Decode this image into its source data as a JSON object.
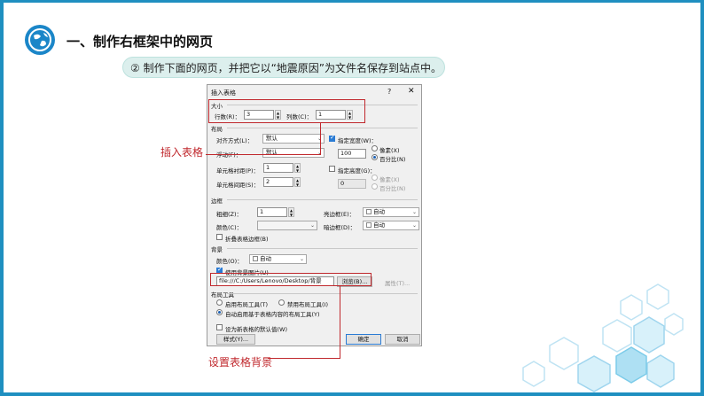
{
  "slide": {
    "title": "一、制作右框架中的网页",
    "subtitle": "② 制作下面的网页，并把它以“地震原因”为文件名保存到站点中。",
    "accent": "#1f8fc0"
  },
  "dialog": {
    "title": "插入表格",
    "help": "?",
    "close": "✕",
    "size": {
      "section": "大小",
      "rows_label": "行数(R)：",
      "rows_value": "3",
      "cols_label": "列数(C)：",
      "cols_value": "1"
    },
    "layout": {
      "section": "布局",
      "align_label": "对齐方式(L)：",
      "align_value": "默认",
      "float_label": "浮动(F)：",
      "float_value": "默认",
      "padding_label": "单元格衬距(P)：",
      "padding_value": "1",
      "spacing_label": "单元格间距(S)：",
      "spacing_value": "2",
      "spec_width_label": "指定宽度(W)：",
      "spec_width_value": "100",
      "pixels_label": "像素(X)",
      "percent_label": "百分比(N)",
      "spec_height_label": "指定高度(G)：",
      "spec_height_value": "0",
      "pixels_label2": "像素(X)",
      "percent_label2": "百分比(N)"
    },
    "border": {
      "section": "边框",
      "thickness_label": "粗细(Z)：",
      "thickness_value": "1",
      "color_label": "颜色(C)：",
      "light_label": "亮边框(E)：",
      "light_value": "自动",
      "dark_label": "暗边框(D)：",
      "dark_value": "自动",
      "collapse_label": "折叠表格边框(B)"
    },
    "background": {
      "section": "背景",
      "color_label": "颜色(O)：",
      "color_value": "自动",
      "use_image_label": "使用背景图片(U)",
      "image_path": "file:///C:/Users/Lenovo/Desktop/背景",
      "browse_label": "浏览(B)...",
      "props_label": "属性(T)..."
    },
    "layout_tools": {
      "section": "布局工具",
      "enable_label": "启用布局工具(T)",
      "disable_label": "禁用布局工具(I)",
      "auto_label": "自动启用基于表格内容的布局工具(Y)"
    },
    "default_label": "设为新表格的默认值(W)",
    "style_label": "样式(Y)...",
    "ok_label": "确定",
    "cancel_label": "取消"
  },
  "annotations": {
    "insert_table": "插入表格",
    "set_background": "设置表格背景",
    "color": "#c0282d"
  }
}
